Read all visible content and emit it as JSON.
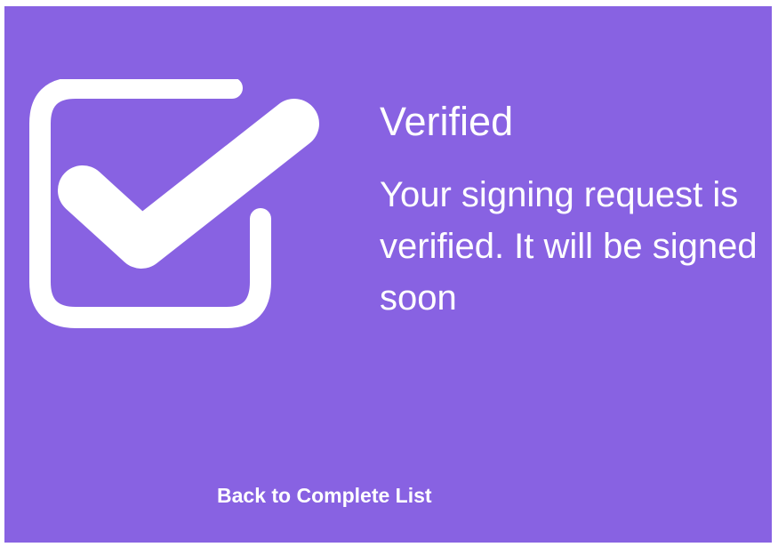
{
  "colors": {
    "background": "#8862e2",
    "foreground": "#ffffff",
    "page": "#ffffff"
  },
  "status": {
    "icon": "checkbox-checked-icon",
    "title": "Verified",
    "message": "Your signing request is verified. It will be signed soon"
  },
  "actions": {
    "back_label": "Back to Complete List"
  }
}
